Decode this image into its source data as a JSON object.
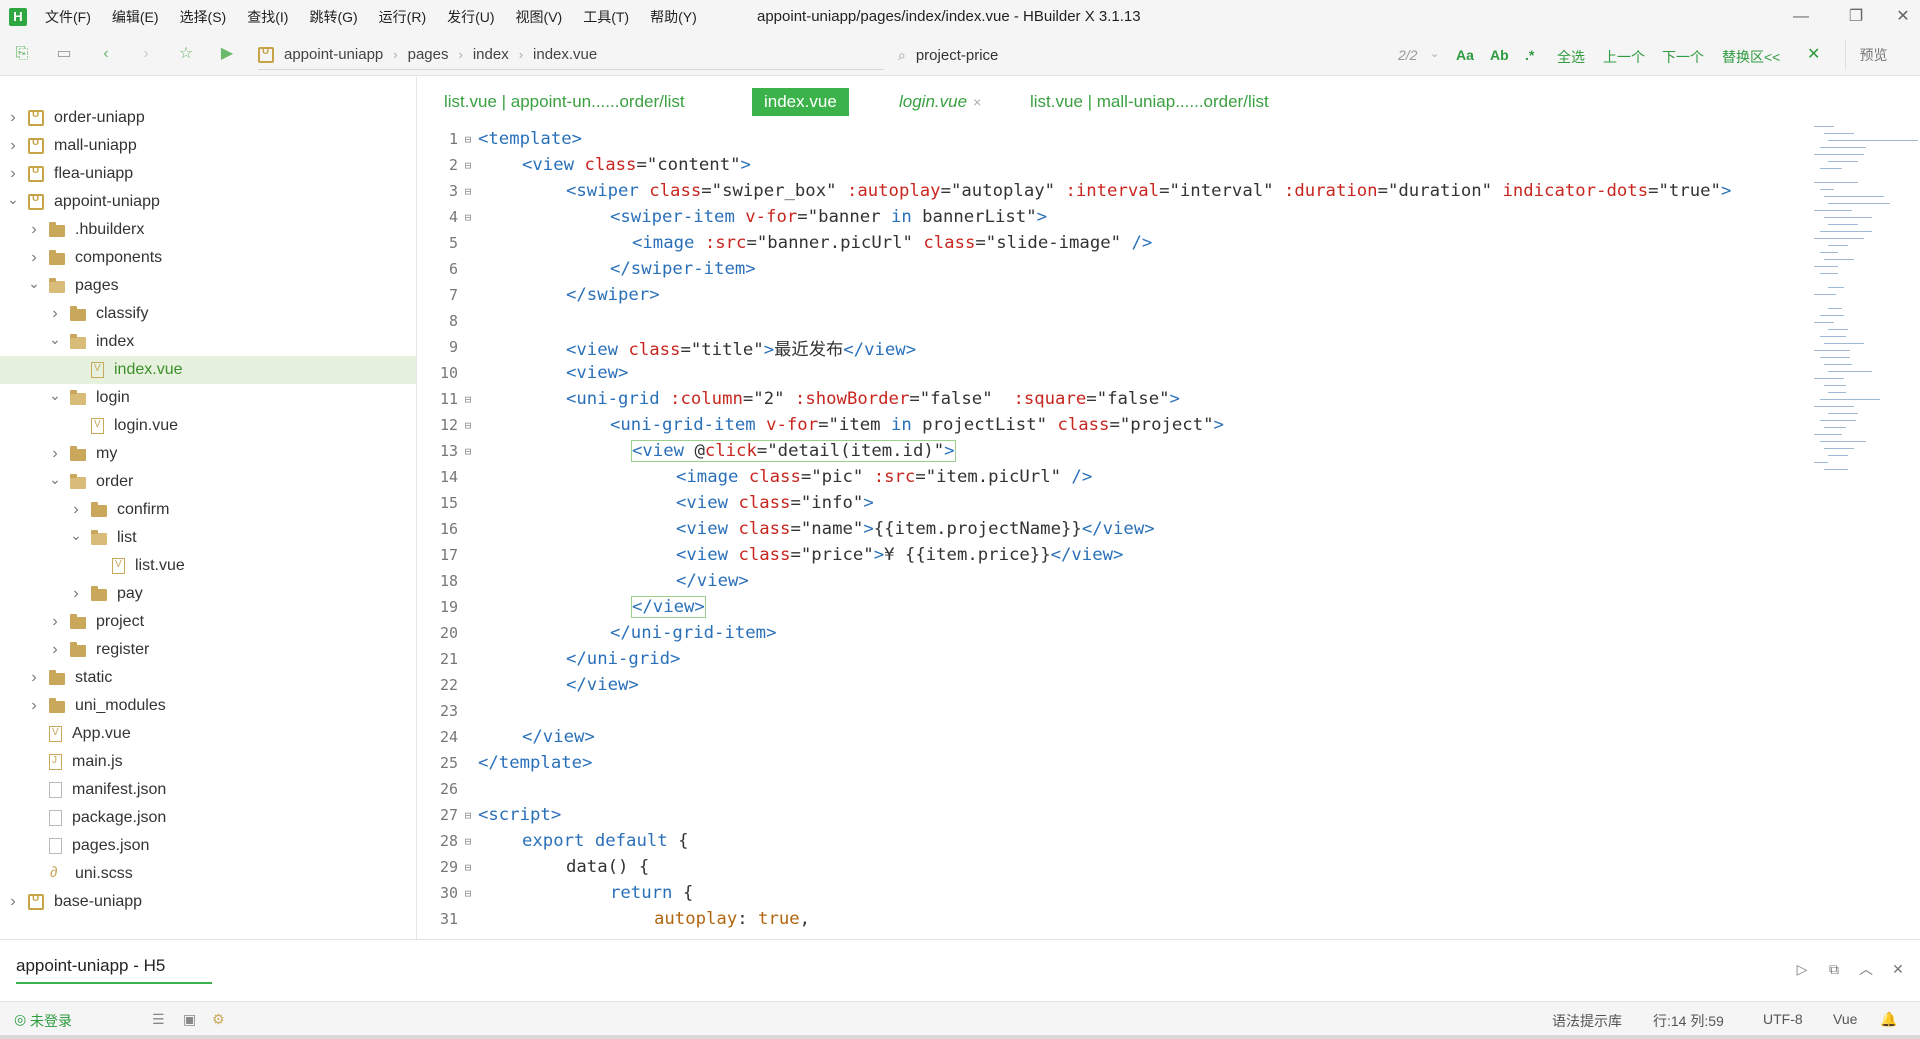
{
  "window": {
    "title": "appoint-uniapp/pages/index/index.vue - HBuilder X 3.1.13",
    "logo": "H",
    "menu": [
      "文件(F)",
      "编辑(E)",
      "选择(S)",
      "查找(I)",
      "跳转(G)",
      "运行(R)",
      "发行(U)",
      "视图(V)",
      "工具(T)",
      "帮助(Y)"
    ]
  },
  "toolbar": {
    "breadcrumb": [
      "appoint-uniapp",
      "pages",
      "index",
      "index.vue"
    ],
    "search_value": "project-price",
    "search_count": "2/2",
    "find_buttons": [
      "全选",
      "上一个",
      "下一个",
      "替换区<<"
    ],
    "preview_label": "预览"
  },
  "sidebar": {
    "items": [
      {
        "label": "order-uniapp",
        "type": "project",
        "depth": 0,
        "chevron": "right"
      },
      {
        "label": "mall-uniapp",
        "type": "project",
        "depth": 0,
        "chevron": "right"
      },
      {
        "label": "flea-uniapp",
        "type": "project",
        "depth": 0,
        "chevron": "right"
      },
      {
        "label": "appoint-uniapp",
        "type": "project",
        "depth": 0,
        "chevron": "down"
      },
      {
        "label": ".hbuilderx",
        "type": "folder",
        "depth": 1,
        "chevron": "right"
      },
      {
        "label": "components",
        "type": "folder",
        "depth": 1,
        "chevron": "right"
      },
      {
        "label": "pages",
        "type": "folder-open",
        "depth": 1,
        "chevron": "down"
      },
      {
        "label": "classify",
        "type": "folder",
        "depth": 2,
        "chevron": "right"
      },
      {
        "label": "index",
        "type": "folder-open",
        "depth": 2,
        "chevron": "down"
      },
      {
        "label": "index.vue",
        "type": "file",
        "depth": 3,
        "chevron": "",
        "selected": true
      },
      {
        "label": "login",
        "type": "folder-open",
        "depth": 2,
        "chevron": "down"
      },
      {
        "label": "login.vue",
        "type": "file",
        "depth": 3,
        "chevron": ""
      },
      {
        "label": "my",
        "type": "folder",
        "depth": 2,
        "chevron": "right"
      },
      {
        "label": "order",
        "type": "folder-open",
        "depth": 2,
        "chevron": "down"
      },
      {
        "label": "confirm",
        "type": "folder",
        "depth": 3,
        "chevron": "right"
      },
      {
        "label": "list",
        "type": "folder-open",
        "depth": 3,
        "chevron": "down"
      },
      {
        "label": "list.vue",
        "type": "file",
        "depth": 4,
        "chevron": ""
      },
      {
        "label": "pay",
        "type": "folder",
        "depth": 3,
        "chevron": "right"
      },
      {
        "label": "project",
        "type": "folder",
        "depth": 2,
        "chevron": "right"
      },
      {
        "label": "register",
        "type": "folder",
        "depth": 2,
        "chevron": "right"
      },
      {
        "label": "static",
        "type": "folder",
        "depth": 1,
        "chevron": "right"
      },
      {
        "label": "uni_modules",
        "type": "folder",
        "depth": 1,
        "chevron": "right"
      },
      {
        "label": "App.vue",
        "type": "file",
        "depth": 1,
        "chevron": ""
      },
      {
        "label": "main.js",
        "type": "js",
        "depth": 1,
        "chevron": ""
      },
      {
        "label": "manifest.json",
        "type": "json",
        "depth": 1,
        "chevron": ""
      },
      {
        "label": "package.json",
        "type": "json",
        "depth": 1,
        "chevron": ""
      },
      {
        "label": "pages.json",
        "type": "json",
        "depth": 1,
        "chevron": ""
      },
      {
        "label": "uni.scss",
        "type": "style",
        "depth": 1,
        "chevron": ""
      },
      {
        "label": "base-uniapp",
        "type": "project",
        "depth": 0,
        "chevron": "right"
      }
    ]
  },
  "tabs": [
    {
      "label": "list.vue | appoint-un......order/list",
      "active": false
    },
    {
      "label": "index.vue",
      "active": true
    },
    {
      "label": "login.vue",
      "active": false,
      "italic": true,
      "closable": true
    },
    {
      "label": "list.vue | mall-uniap......order/list",
      "active": false
    }
  ],
  "editor": {
    "lines": [
      {
        "n": "1",
        "fold": true,
        "indent": 0,
        "tokens": [
          [
            "tag",
            "<template>"
          ]
        ]
      },
      {
        "n": "2",
        "fold": true,
        "indent": 1,
        "tokens": [
          [
            "tag",
            "<view "
          ],
          [
            "attr",
            "class"
          ],
          [
            "plain",
            "="
          ],
          [
            "str",
            "\"content\""
          ],
          [
            "tag",
            ">"
          ]
        ]
      },
      {
        "n": "3",
        "fold": true,
        "indent": 2,
        "tokens": [
          [
            "tag",
            "<swiper "
          ],
          [
            "attr",
            "class"
          ],
          [
            "plain",
            "="
          ],
          [
            "str",
            "\"swiper_box\""
          ],
          [
            "plain",
            " "
          ],
          [
            "attr",
            ":autoplay"
          ],
          [
            "plain",
            "="
          ],
          [
            "str",
            "\"autoplay\""
          ],
          [
            "plain",
            " "
          ],
          [
            "attr",
            ":interval"
          ],
          [
            "plain",
            "="
          ],
          [
            "str",
            "\"interval\""
          ],
          [
            "plain",
            " "
          ],
          [
            "attr",
            ":duration"
          ],
          [
            "plain",
            "="
          ],
          [
            "str",
            "\"duration\""
          ],
          [
            "plain",
            " "
          ],
          [
            "attr",
            "indicator-dots"
          ],
          [
            "plain",
            "="
          ],
          [
            "str",
            "\"true\""
          ],
          [
            "tag",
            ">"
          ]
        ]
      },
      {
        "n": "4",
        "fold": true,
        "indent": 3,
        "tokens": [
          [
            "tag",
            "<swiper-item "
          ],
          [
            "attr",
            "v-for"
          ],
          [
            "plain",
            "="
          ],
          [
            "str",
            "\"banner "
          ],
          [
            "kw",
            "in"
          ],
          [
            "str",
            " bannerList\""
          ],
          [
            "tag",
            ">"
          ]
        ]
      },
      {
        "n": "5",
        "fold": false,
        "indent": 3.5,
        "tokens": [
          [
            "tag",
            "<image "
          ],
          [
            "attr",
            ":src"
          ],
          [
            "plain",
            "="
          ],
          [
            "str",
            "\"banner.picUrl\""
          ],
          [
            "plain",
            " "
          ],
          [
            "attr",
            "class"
          ],
          [
            "plain",
            "="
          ],
          [
            "str",
            "\"slide-image\""
          ],
          [
            "plain",
            " "
          ],
          [
            "tag",
            "/>"
          ]
        ]
      },
      {
        "n": "6",
        "fold": false,
        "indent": 3,
        "tokens": [
          [
            "tag",
            "</swiper-item>"
          ]
        ]
      },
      {
        "n": "7",
        "fold": false,
        "indent": 2,
        "tokens": [
          [
            "tag",
            "</swiper>"
          ]
        ]
      },
      {
        "n": "8",
        "fold": false,
        "indent": 0,
        "tokens": []
      },
      {
        "n": "9",
        "fold": false,
        "indent": 2,
        "tokens": [
          [
            "tag",
            "<view "
          ],
          [
            "attr",
            "class"
          ],
          [
            "plain",
            "="
          ],
          [
            "str",
            "\"title\""
          ],
          [
            "tag",
            ">"
          ],
          [
            "plain",
            "最近发布"
          ],
          [
            "tag",
            "</view>"
          ]
        ]
      },
      {
        "n": "10",
        "fold": false,
        "indent": 2,
        "tokens": [
          [
            "tag",
            "<view>"
          ]
        ]
      },
      {
        "n": "11",
        "fold": true,
        "indent": 2,
        "tokens": [
          [
            "tag",
            "<uni-grid "
          ],
          [
            "attr",
            ":column"
          ],
          [
            "plain",
            "="
          ],
          [
            "str",
            "\"2\""
          ],
          [
            "plain",
            " "
          ],
          [
            "attr",
            ":showBorder"
          ],
          [
            "plain",
            "="
          ],
          [
            "str",
            "\"false\""
          ],
          [
            "plain",
            "  "
          ],
          [
            "attr",
            ":square"
          ],
          [
            "plain",
            "="
          ],
          [
            "str",
            "\"false\""
          ],
          [
            "tag",
            ">"
          ]
        ]
      },
      {
        "n": "12",
        "fold": true,
        "indent": 3,
        "tokens": [
          [
            "tag",
            "<uni-grid-item "
          ],
          [
            "attr",
            "v-for"
          ],
          [
            "plain",
            "="
          ],
          [
            "str",
            "\"item "
          ],
          [
            "kw",
            "in"
          ],
          [
            "str",
            " projectList\""
          ],
          [
            "plain",
            " "
          ],
          [
            "attr",
            "class"
          ],
          [
            "plain",
            "="
          ],
          [
            "str",
            "\"project\""
          ],
          [
            "tag",
            ">"
          ]
        ]
      },
      {
        "n": "13",
        "fold": true,
        "indent": 3.5,
        "box": true,
        "tokens": [
          [
            "tag",
            "<view "
          ],
          [
            "plain",
            "@"
          ],
          [
            "attr",
            "click"
          ],
          [
            "plain",
            "="
          ],
          [
            "str",
            "\"detail(item.id)\""
          ],
          [
            "tag",
            ">"
          ]
        ]
      },
      {
        "n": "14",
        "fold": false,
        "indent": 4.5,
        "tokens": [
          [
            "tag",
            "<image "
          ],
          [
            "attr",
            "class"
          ],
          [
            "plain",
            "="
          ],
          [
            "str",
            "\"pic\""
          ],
          [
            "plain",
            " "
          ],
          [
            "attr",
            ":src"
          ],
          [
            "plain",
            "="
          ],
          [
            "str",
            "\"item.picUrl\""
          ],
          [
            "plain",
            " "
          ],
          [
            "tag",
            "/>"
          ]
        ]
      },
      {
        "n": "15",
        "fold": false,
        "indent": 4.5,
        "tokens": [
          [
            "tag",
            "<view "
          ],
          [
            "attr",
            "class"
          ],
          [
            "plain",
            "="
          ],
          [
            "str",
            "\"info\""
          ],
          [
            "tag",
            ">"
          ]
        ]
      },
      {
        "n": "16",
        "fold": false,
        "indent": 4.5,
        "tokens": [
          [
            "tag",
            "<view "
          ],
          [
            "attr",
            "class"
          ],
          [
            "plain",
            "="
          ],
          [
            "str",
            "\"name\""
          ],
          [
            "tag",
            ">"
          ],
          [
            "plain",
            "{{item.projectName}}"
          ],
          [
            "tag",
            "</view>"
          ]
        ]
      },
      {
        "n": "17",
        "fold": false,
        "indent": 4.5,
        "tokens": [
          [
            "tag",
            "<view "
          ],
          [
            "attr",
            "class"
          ],
          [
            "plain",
            "="
          ],
          [
            "str",
            "\"price\""
          ],
          [
            "tag",
            ">"
          ],
          [
            "plain",
            "¥ {{item.price}}"
          ],
          [
            "tag",
            "</view>"
          ]
        ]
      },
      {
        "n": "18",
        "fold": false,
        "indent": 4.5,
        "tokens": [
          [
            "tag",
            "</view>"
          ]
        ]
      },
      {
        "n": "19",
        "fold": false,
        "indent": 3.5,
        "box": true,
        "tokens": [
          [
            "tag",
            "</view>"
          ]
        ]
      },
      {
        "n": "20",
        "fold": false,
        "indent": 3,
        "tokens": [
          [
            "tag",
            "</uni-grid-item>"
          ]
        ]
      },
      {
        "n": "21",
        "fold": false,
        "indent": 2,
        "tokens": [
          [
            "tag",
            "</uni-grid>"
          ]
        ]
      },
      {
        "n": "22",
        "fold": false,
        "indent": 2,
        "tokens": [
          [
            "tag",
            "</view>"
          ]
        ]
      },
      {
        "n": "23",
        "fold": false,
        "indent": 0,
        "tokens": []
      },
      {
        "n": "24",
        "fold": false,
        "indent": 1,
        "tokens": [
          [
            "tag",
            "</view>"
          ]
        ]
      },
      {
        "n": "25",
        "fold": false,
        "indent": 0,
        "tokens": [
          [
            "tag",
            "</template>"
          ]
        ]
      },
      {
        "n": "26",
        "fold": false,
        "indent": 0,
        "tokens": []
      },
      {
        "n": "27",
        "fold": true,
        "indent": 0,
        "tokens": [
          [
            "tag",
            "<script>"
          ]
        ]
      },
      {
        "n": "28",
        "fold": true,
        "indent": 1,
        "tokens": [
          [
            "kw",
            "export default "
          ],
          [
            "plain",
            "{"
          ]
        ]
      },
      {
        "n": "29",
        "fold": true,
        "indent": 2,
        "tokens": [
          [
            "plain",
            "data() {"
          ]
        ]
      },
      {
        "n": "30",
        "fold": true,
        "indent": 3,
        "tokens": [
          [
            "kw",
            "return "
          ],
          [
            "plain",
            "{"
          ]
        ]
      },
      {
        "n": "31",
        "fold": false,
        "indent": 4,
        "tokens": [
          [
            "var",
            "autoplay"
          ],
          [
            "plain",
            ": "
          ],
          [
            "bool",
            "true"
          ],
          [
            "plain",
            ","
          ]
        ]
      }
    ]
  },
  "panel": {
    "console_tab": "appoint-uniapp - H5"
  },
  "status": {
    "login": "未登录",
    "syntax_lib": "语法提示库",
    "cursor": "行:14  列:59",
    "encoding": "UTF-8",
    "language": "Vue"
  },
  "colors": {
    "accent": "#3bb24a",
    "tag": "#2a70b9",
    "attr": "#c8261f",
    "selection": "#e6f2dd"
  }
}
